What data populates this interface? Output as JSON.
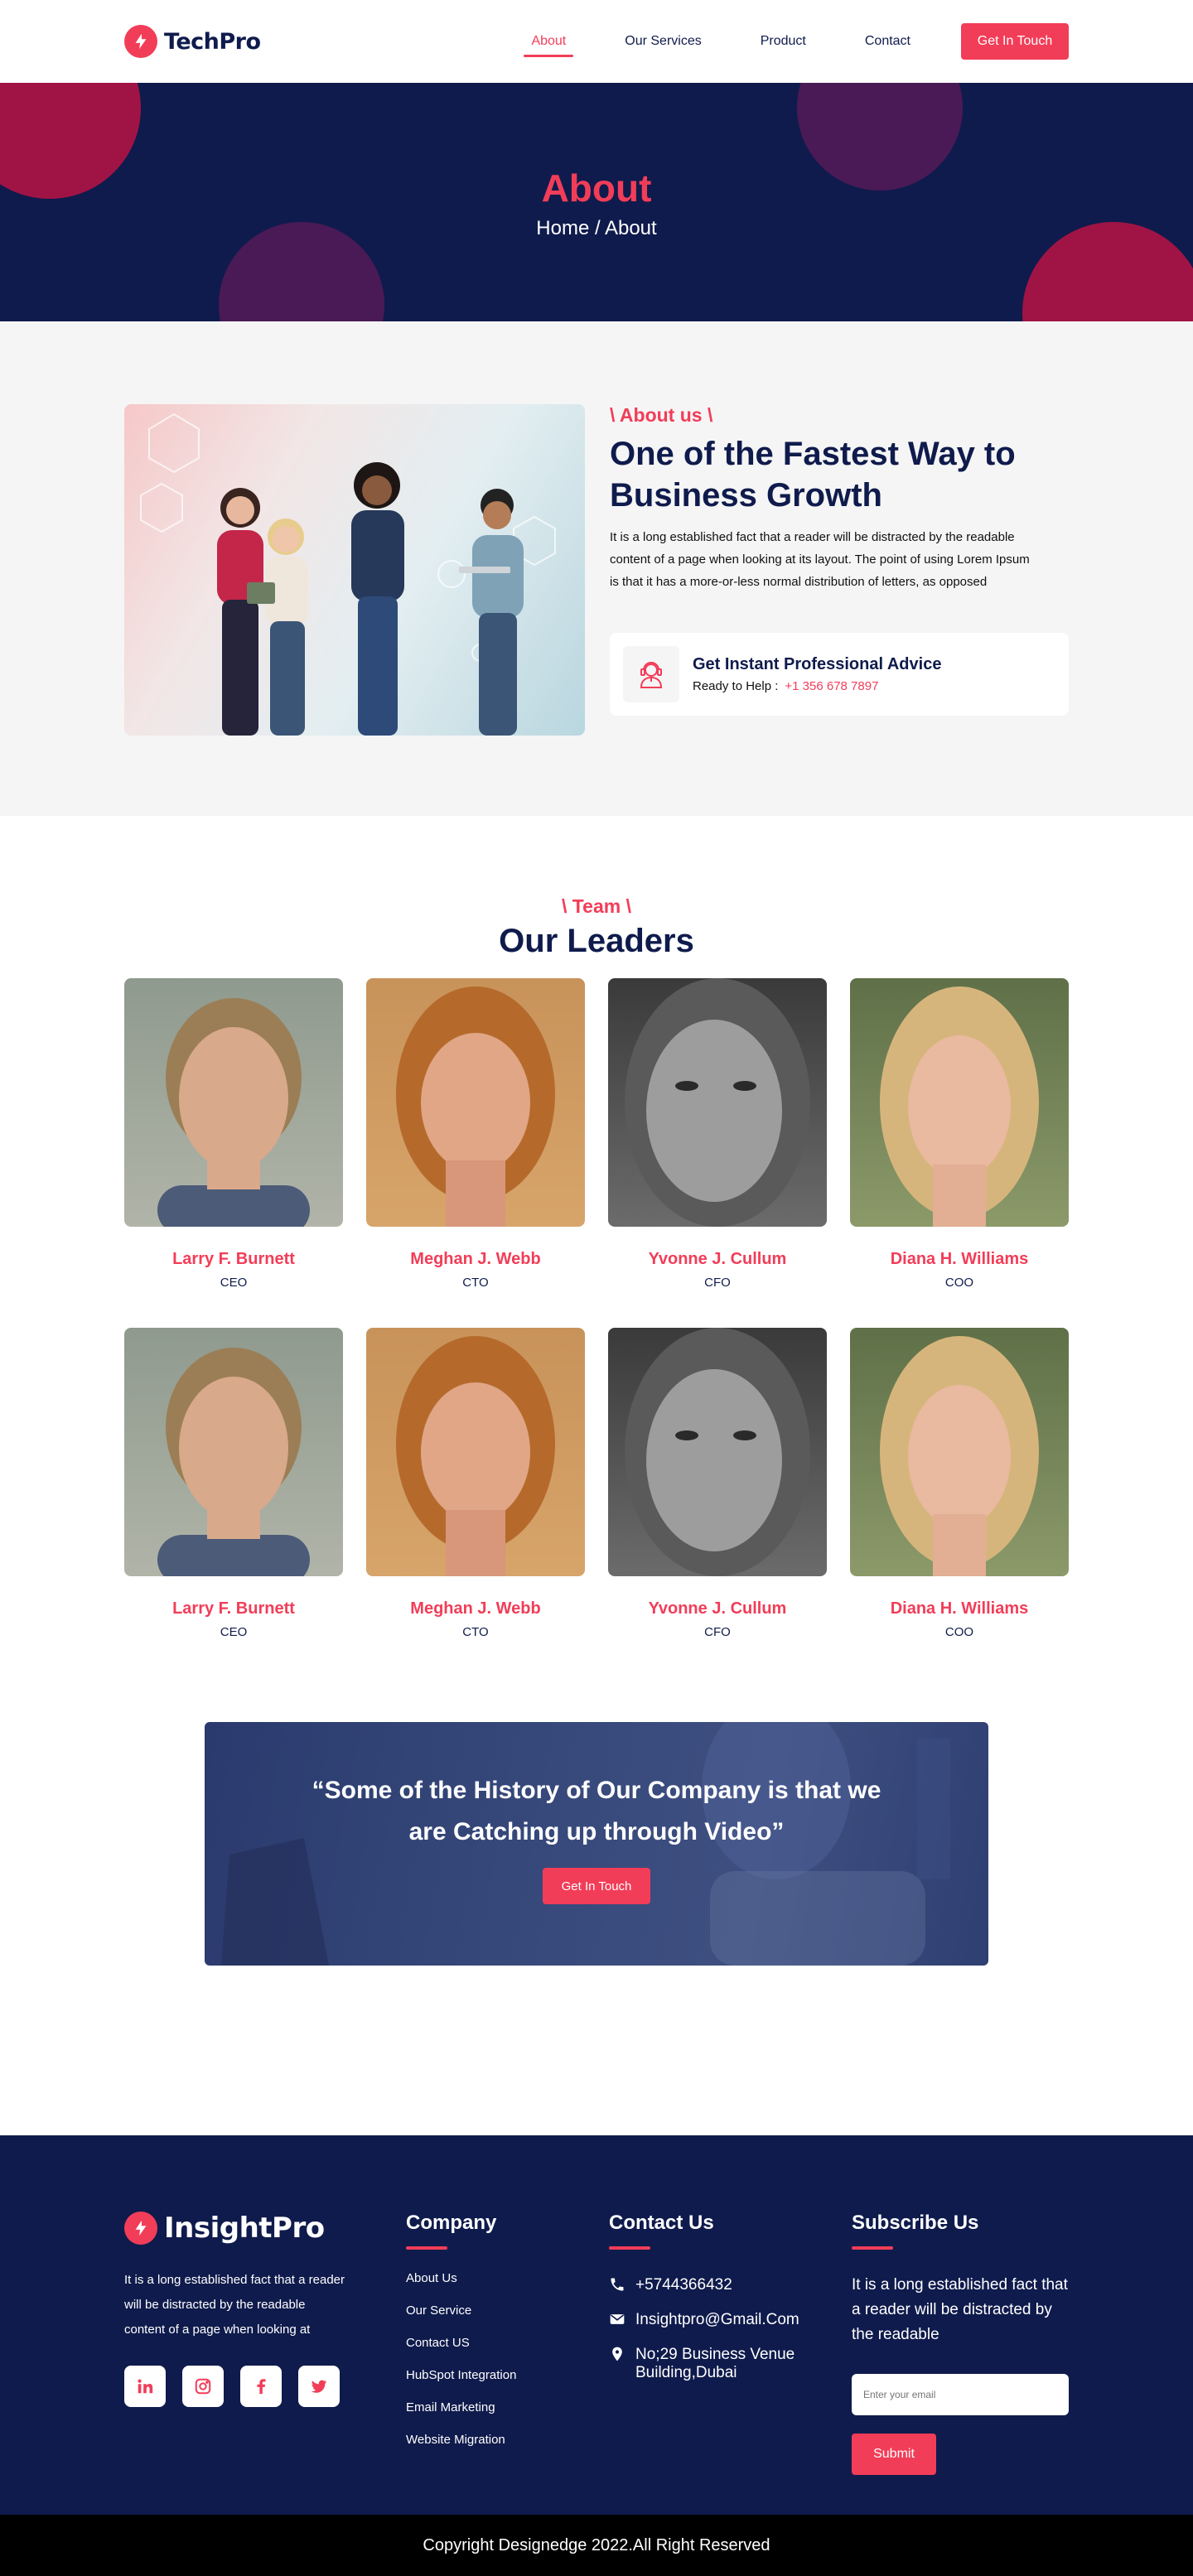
{
  "brand": {
    "name": "TechPro",
    "accent": "#f23d58",
    "navy": "#0f1b4c"
  },
  "nav": {
    "items": [
      {
        "label": "About",
        "active": true
      },
      {
        "label": "Our Services",
        "active": false
      },
      {
        "label": "Product",
        "active": false
      },
      {
        "label": "Contact",
        "active": false
      }
    ],
    "cta": "Get In Touch"
  },
  "hero": {
    "title": "About",
    "breadcrumb": "Home / About"
  },
  "about": {
    "kicker": "\\ About us \\",
    "title": "One of the Fastest Way to Business Growth",
    "text": "It is a long established fact that a reader will be distracted by the readable content of a page when looking at its layout. The point of using Lorem Ipsum is that it has a more-or-less normal distribution of letters, as opposed",
    "advice": {
      "title": "Get Instant Professional Advice",
      "label": "Ready to Help :",
      "phone": "+1 356 678 7897"
    }
  },
  "team": {
    "kicker": "\\ Team \\",
    "title": "Our Leaders",
    "members": [
      {
        "name": "Larry F. Burnett",
        "role": "CEO"
      },
      {
        "name": "Meghan J. Webb",
        "role": "CTO"
      },
      {
        "name": "Yvonne J. Cullum",
        "role": "CFO"
      },
      {
        "name": "Diana H. Williams",
        "role": "COO"
      },
      {
        "name": "Larry F. Burnett",
        "role": "CEO"
      },
      {
        "name": "Meghan J. Webb",
        "role": "CTO"
      },
      {
        "name": "Yvonne J. Cullum",
        "role": "CFO"
      },
      {
        "name": "Diana H. Williams",
        "role": "COO"
      }
    ]
  },
  "video": {
    "quote": "“Some of the History of Our Company is that we are Catching up through Video”",
    "cta": "Get In Touch"
  },
  "footer": {
    "brand": "InsightPro",
    "about": "It is a long established fact that a reader will be distracted by the readable content of a page when looking at",
    "socials": [
      "linkedin-icon",
      "instagram-icon",
      "facebook-icon",
      "twitter-icon"
    ],
    "company": {
      "heading": "Company",
      "links": [
        "About Us",
        "Our Service",
        "Contact US",
        "HubSpot Integration",
        "Email Marketing",
        "Website Migration"
      ]
    },
    "contact": {
      "heading": "Contact Us",
      "phone": "+5744366432",
      "email": "Insightpro@Gmail.Com",
      "address": "No;29 Business Venue Building,Dubai"
    },
    "subscribe": {
      "heading": "Subscribe Us",
      "text": "It is a long established fact that a reader will be distracted by the readable",
      "placeholder": "Enter your email",
      "button": "Submit"
    }
  },
  "copyright": "Copyright Designedge 2022.All Right Reserved"
}
